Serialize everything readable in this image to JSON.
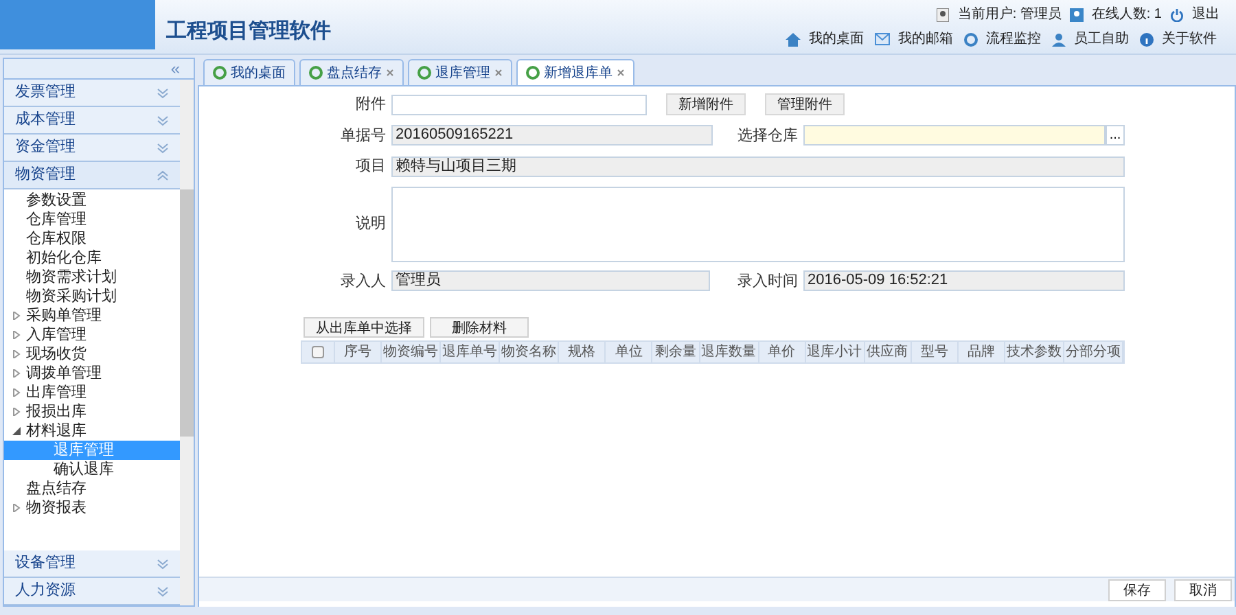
{
  "header": {
    "title": "工程项目管理软件",
    "user_label": "当前用户: 管理员",
    "online_label": "在线人数: 1",
    "logout": "退出",
    "links": [
      {
        "label": "我的桌面",
        "kind": "home"
      },
      {
        "label": "我的邮箱",
        "kind": "mail"
      },
      {
        "label": "流程监控",
        "kind": "monitor"
      },
      {
        "label": "员工自助",
        "kind": "person"
      },
      {
        "label": "关于软件",
        "kind": "info"
      }
    ]
  },
  "sidebar": {
    "collapse": "«",
    "groups_before": [
      {
        "label": "发票管理",
        "expanded": false
      },
      {
        "label": "成本管理",
        "expanded": false
      },
      {
        "label": "资金管理",
        "expanded": false
      },
      {
        "label": "物资管理",
        "expanded": true
      }
    ],
    "items": [
      {
        "label": "参数设置",
        "kind": "leaf",
        "selected": false
      },
      {
        "label": "仓库管理",
        "kind": "leaf",
        "selected": false
      },
      {
        "label": "仓库权限",
        "kind": "leaf",
        "selected": false
      },
      {
        "label": "初始化仓库",
        "kind": "leaf",
        "selected": false
      },
      {
        "label": "物资需求计划",
        "kind": "leaf",
        "selected": false
      },
      {
        "label": "物资采购计划",
        "kind": "leaf",
        "selected": false
      },
      {
        "label": "采购单管理",
        "kind": "branch",
        "expanded": false
      },
      {
        "label": "入库管理",
        "kind": "branch",
        "expanded": false
      },
      {
        "label": "现场收货",
        "kind": "branch",
        "expanded": false
      },
      {
        "label": "调拨单管理",
        "kind": "branch",
        "expanded": false
      },
      {
        "label": "出库管理",
        "kind": "branch",
        "expanded": false
      },
      {
        "label": "报损出库",
        "kind": "branch",
        "expanded": false
      },
      {
        "label": "材料退库",
        "kind": "branch",
        "expanded": true,
        "children": [
          {
            "label": "退库管理",
            "kind": "leaf",
            "selected": true
          },
          {
            "label": "确认退库",
            "kind": "leaf",
            "selected": false
          }
        ]
      },
      {
        "label": "盘点结存",
        "kind": "leaf",
        "selected": false
      },
      {
        "label": "物资报表",
        "kind": "branch",
        "expanded": false
      }
    ],
    "groups_after": [
      {
        "label": "设备管理",
        "expanded": false
      },
      {
        "label": "人力资源",
        "expanded": false
      }
    ]
  },
  "tabs": [
    {
      "label": "我的桌面",
      "closable": false,
      "selected": false
    },
    {
      "label": "盘点结存",
      "closable": true,
      "selected": false
    },
    {
      "label": "退库管理",
      "closable": true,
      "selected": false
    },
    {
      "label": "新增退库单",
      "closable": true,
      "selected": true
    }
  ],
  "form": {
    "attachment": {
      "label": "附件",
      "buttons": [
        "新增附件",
        "管理附件"
      ]
    },
    "doc_no": {
      "label": "单据号",
      "value": "20160509165221"
    },
    "warehouse": {
      "label": "选择仓库",
      "picker": "..."
    },
    "project": {
      "label": "项目",
      "value": "赖特与山项目三期"
    },
    "note": {
      "label": "说明"
    },
    "entered_by": {
      "label": "录入人",
      "value": "管理员"
    },
    "entered_at": {
      "label": "录入时间",
      "value": "2016-05-09 16:52:21"
    }
  },
  "grid": {
    "buttons": [
      "从出库单中选择",
      "删除材料"
    ],
    "select_all": false,
    "columns": [
      "序号",
      "物资编号",
      "退库单号",
      "物资名称",
      "规格",
      "单位",
      "剩余量",
      "退库数量",
      "单价",
      "退库小计",
      "供应商",
      "型号",
      "品牌",
      "技术参数",
      "分部分项"
    ]
  },
  "footer": {
    "buttons": [
      "保存",
      "取消"
    ]
  }
}
